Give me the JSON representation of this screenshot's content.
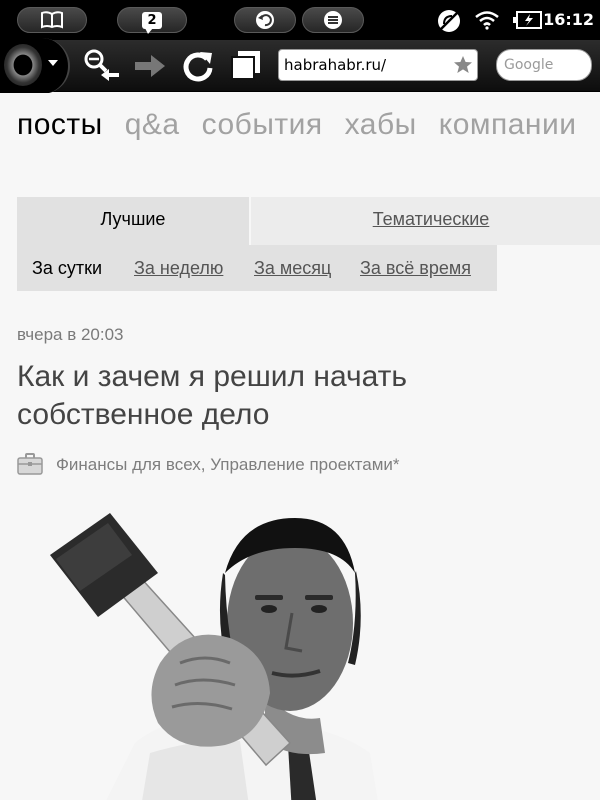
{
  "status": {
    "badge_count": "2",
    "time": "16:12"
  },
  "browser": {
    "url": "habrahabr.ru/",
    "search_placeholder": "Google"
  },
  "nav": {
    "items": [
      "посты",
      "q&a",
      "события",
      "хабы",
      "компании"
    ]
  },
  "tabs": {
    "best": "Лучшие",
    "topical": "Тематические"
  },
  "periods": {
    "day": "За сутки",
    "week": "За неделю",
    "month": "За месяц",
    "all": "За всё время"
  },
  "post": {
    "date": "вчера в  20:03",
    "title": "Как и зачем я решил начать собственное дело",
    "hubs": "Финансы для всех, Управление проектами*"
  },
  "icons": {
    "status": [
      "book-icon",
      "notification-icon",
      "back-icon",
      "menu-icon",
      "sync-off-icon",
      "wifi-icon",
      "battery-icon"
    ],
    "toolbar": [
      "opera-menu-icon",
      "zoom-out-icon",
      "forward-icon",
      "reload-icon",
      "tabs-icon",
      "star-icon"
    ],
    "post": [
      "briefcase-icon"
    ]
  }
}
